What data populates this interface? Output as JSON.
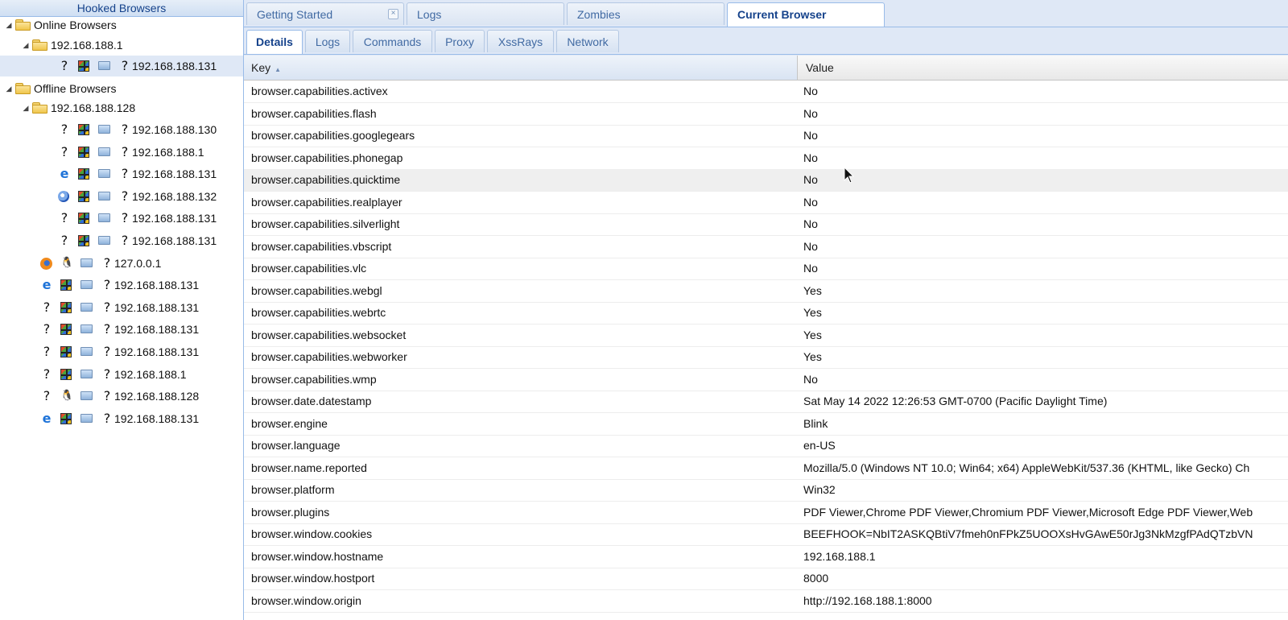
{
  "left_panel": {
    "title": "Hooked Browsers",
    "online": {
      "label": "Online Browsers",
      "group": "192.168.188.1",
      "browsers": [
        {
          "ip": "192.168.188.131",
          "browser_icon": "unknown-icon"
        }
      ]
    },
    "offline": {
      "label": "Offline Browsers",
      "group": "192.168.188.128",
      "grouped_browsers": [
        {
          "ip": "192.168.188.130",
          "browser_icon": "unknown-icon"
        },
        {
          "ip": "192.168.188.1",
          "browser_icon": "unknown-icon"
        },
        {
          "ip": "192.168.188.131",
          "browser_icon": "edge-icon"
        },
        {
          "ip": "192.168.188.132",
          "browser_icon": "ie-icon"
        },
        {
          "ip": "192.168.188.131",
          "browser_icon": "unknown-icon"
        },
        {
          "ip": "192.168.188.131",
          "browser_icon": "unknown-icon"
        }
      ],
      "browsers": [
        {
          "ip": "127.0.0.1",
          "browser_icon": "firefox-icon",
          "os_icon": "linux-icon"
        },
        {
          "ip": "192.168.188.131",
          "browser_icon": "edge-icon",
          "os_icon": "windows-icon"
        },
        {
          "ip": "192.168.188.131",
          "browser_icon": "unknown-icon",
          "os_icon": "windows-icon"
        },
        {
          "ip": "192.168.188.131",
          "browser_icon": "unknown-icon",
          "os_icon": "windows-icon"
        },
        {
          "ip": "192.168.188.131",
          "browser_icon": "unknown-icon",
          "os_icon": "windows-icon"
        },
        {
          "ip": "192.168.188.1",
          "browser_icon": "unknown-icon",
          "os_icon": "windows-icon"
        },
        {
          "ip": "192.168.188.128",
          "browser_icon": "unknown-icon",
          "os_icon": "linux-icon"
        },
        {
          "ip": "192.168.188.131",
          "browser_icon": "edge-icon",
          "os_icon": "windows-icon"
        }
      ]
    }
  },
  "top_tabs": [
    {
      "label": "Getting Started",
      "closable": true
    },
    {
      "label": "Logs"
    },
    {
      "label": "Zombies"
    },
    {
      "label": "Current Browser",
      "active": true
    }
  ],
  "sub_tabs": [
    {
      "label": "Details",
      "active": true
    },
    {
      "label": "Logs"
    },
    {
      "label": "Commands"
    },
    {
      "label": "Proxy"
    },
    {
      "label": "XssRays"
    },
    {
      "label": "Network"
    }
  ],
  "grid": {
    "headers": {
      "key": "Key",
      "value": "Value"
    },
    "rows": [
      {
        "key": "browser.capabilities.activex",
        "value": "No"
      },
      {
        "key": "browser.capabilities.flash",
        "value": "No"
      },
      {
        "key": "browser.capabilities.googlegears",
        "value": "No"
      },
      {
        "key": "browser.capabilities.phonegap",
        "value": "No"
      },
      {
        "key": "browser.capabilities.quicktime",
        "value": "No"
      },
      {
        "key": "browser.capabilities.realplayer",
        "value": "No"
      },
      {
        "key": "browser.capabilities.silverlight",
        "value": "No"
      },
      {
        "key": "browser.capabilities.vbscript",
        "value": "No"
      },
      {
        "key": "browser.capabilities.vlc",
        "value": "No"
      },
      {
        "key": "browser.capabilities.webgl",
        "value": "Yes"
      },
      {
        "key": "browser.capabilities.webrtc",
        "value": "Yes"
      },
      {
        "key": "browser.capabilities.websocket",
        "value": "Yes"
      },
      {
        "key": "browser.capabilities.webworker",
        "value": "Yes"
      },
      {
        "key": "browser.capabilities.wmp",
        "value": "No"
      },
      {
        "key": "browser.date.datestamp",
        "value": "Sat May 14 2022 12:26:53 GMT-0700 (Pacific Daylight Time)"
      },
      {
        "key": "browser.engine",
        "value": "Blink"
      },
      {
        "key": "browser.language",
        "value": "en-US"
      },
      {
        "key": "browser.name.reported",
        "value": "Mozilla/5.0 (Windows NT 10.0; Win64; x64) AppleWebKit/537.36 (KHTML, like Gecko) Ch"
      },
      {
        "key": "browser.platform",
        "value": "Win32"
      },
      {
        "key": "browser.plugins",
        "value": "PDF Viewer,Chrome PDF Viewer,Chromium PDF Viewer,Microsoft Edge PDF Viewer,Web"
      },
      {
        "key": "browser.window.cookies",
        "value": "BEEFHOOK=NbIT2ASKQBtiV7fmeh0nFPkZ5UOOXsHvGAwE50rJg3NkMzgfPAdQTzbVN"
      },
      {
        "key": "browser.window.hostname",
        "value": "192.168.188.1"
      },
      {
        "key": "browser.window.hostport",
        "value": "8000"
      },
      {
        "key": "browser.window.origin",
        "value": "http://192.168.188.1:8000"
      }
    ],
    "hover_row": "browser.capabilities.quicktime"
  }
}
